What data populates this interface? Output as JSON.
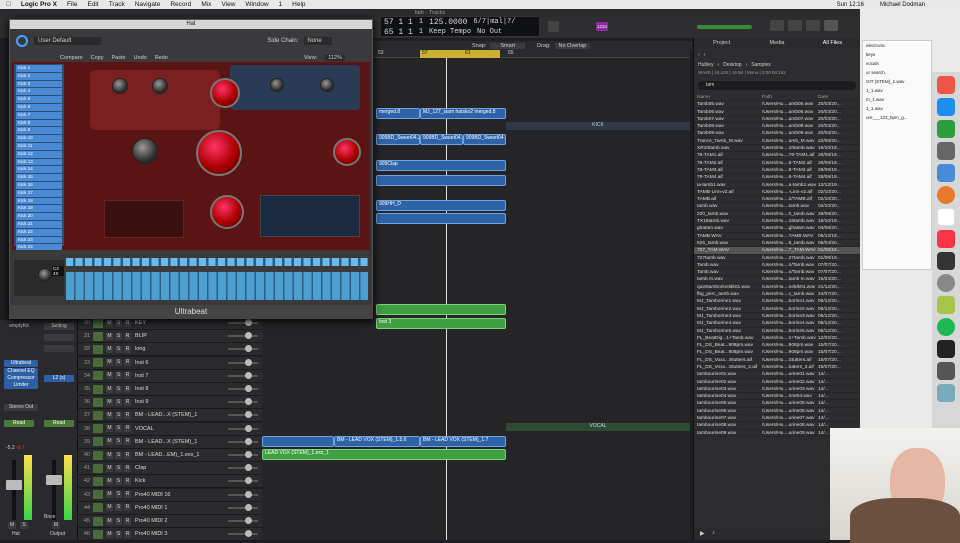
{
  "menubar": {
    "app": "Logic Pro X",
    "items": [
      "File",
      "Edit",
      "Track",
      "Navigate",
      "Record",
      "Mix",
      "View",
      "Window",
      "1",
      "Help"
    ],
    "clock": "Sun 12:16",
    "user": "Michael Dodman"
  },
  "window_title": "fadr - Tracks",
  "lcd": {
    "bar1": "57 1 1",
    "beat1": "1",
    "tempo": "125.0000",
    "sig": "6/7|mal|7/",
    "bar2": "65 1 1",
    "beat2": "1",
    "keep": "Keep Tempo",
    "no_out": "No Out"
  },
  "cpu_badge": "1234",
  "snap": {
    "label": "Snap:",
    "value": "Smart"
  },
  "drag": {
    "label": "Drag:",
    "value": "No Overlap"
  },
  "ruler_marks": [
    "53",
    "57",
    "61",
    "65"
  ],
  "ultrabeat": {
    "title": "Hat",
    "preset": "User Default",
    "sidechain_label": "Side Chain:",
    "sidechain_value": "None",
    "compare": "Compare",
    "copy": "Copy",
    "paste": "Paste",
    "undo": "Undo",
    "redo": "Redo",
    "view_label": "View:",
    "view_value": "112%",
    "footer": "Ultrabeat",
    "voice_value": "C3 4X",
    "drums": [
      "Kick 1",
      "Kick 2",
      "Kick 3",
      "Kick 4",
      "Kick 5",
      "Kick 6",
      "Kick 7",
      "Kick 8",
      "Kick 9",
      "Kick 10",
      "Kick 11",
      "Kick 12",
      "Kick 13",
      "Kick 14",
      "Kick 15",
      "Kick 16",
      "Kick 17",
      "Kick 18",
      "Kick 19",
      "Kick 20",
      "Kick 21",
      "Kick 22",
      "Kick 23",
      "Kick 24",
      "Kick 25"
    ]
  },
  "regions": [
    {
      "text": "merged.8",
      "color": "blue"
    },
    {
      "text": "MJ_127_siam hatsko2 merged.8",
      "color": "blue"
    },
    {
      "text": "909BD_Sweet04.21",
      "color": "blue"
    },
    {
      "text": "909BD_Sweet04.22",
      "color": "blue"
    },
    {
      "text": "909BD_Sweet04.23",
      "color": "blue"
    },
    {
      "text": "909Clap",
      "color": "blue"
    },
    {
      "text": "909HH_D",
      "color": "blue"
    },
    {
      "text": "Inst 3",
      "color": "green"
    },
    {
      "text": "BM - LEAD VOX (STEM)_1.5.6",
      "color": "blue"
    },
    {
      "text": "BM - LEAD VOX (STEM)_1.5.8",
      "color": "blue"
    },
    {
      "text": "BM - LEAD VOX (STEM)_1.7",
      "color": "blue"
    },
    {
      "text": "LEAD VOX (STEM)_1.exs_1",
      "color": "green"
    }
  ],
  "markers": {
    "kick": "KICK",
    "vocal": "VOCAL"
  },
  "tracks": [
    {
      "num": "30",
      "name": "KEY"
    },
    {
      "num": "31",
      "name": "BLIP"
    },
    {
      "num": "32",
      "name": "long"
    },
    {
      "num": "33",
      "name": "Inst 6"
    },
    {
      "num": "34",
      "name": "Inst 7"
    },
    {
      "num": "35",
      "name": "Inst 8"
    },
    {
      "num": "36",
      "name": "Inst 9"
    },
    {
      "num": "37",
      "name": "BM - LEAD...X (STEM)_1"
    },
    {
      "num": "38",
      "name": "VOCAL"
    },
    {
      "num": "39",
      "name": "BM - LEAD...X (STEM)_1"
    },
    {
      "num": "40",
      "name": "BM - LEAD...EM)_1.exs_1"
    },
    {
      "num": "41",
      "name": "Clap"
    },
    {
      "num": "42",
      "name": "Kick"
    },
    {
      "num": "43",
      "name": "Pro40 MIDI 16"
    },
    {
      "num": "44",
      "name": "Pro40 MIDI 1"
    },
    {
      "num": "45",
      "name": "Pro40 MIDI 2"
    },
    {
      "num": "46",
      "name": "Pro40 MIDI 3"
    }
  ],
  "mixer": {
    "plugin": "emptyKit",
    "setting": "Setting",
    "ultrabeat": "Ultrabeat",
    "channel_eq": "Channel EQ",
    "compressor": "Compressor",
    "limiter": "Limiter",
    "l2": "L2 (s)",
    "stereo_out": "Stereo Out",
    "read": "Read",
    "vol1": "-5.2",
    "vol2": "-9.7",
    "bnce": "Bnce",
    "hat": "Hat",
    "output": "Output",
    "m": "M",
    "s": "S"
  },
  "browser": {
    "tabs": [
      "Project",
      "Media",
      "All Files"
    ],
    "path": [
      "Hubley",
      "Desktop",
      "Samples"
    ],
    "info": "WAVE | 44,100 | 16 Bit | Mono | 0:00:00:162",
    "search": "tam",
    "cols": [
      "Name",
      "Path",
      "Date"
    ],
    "files": [
      [
        "Tamb05.wav",
        "/Users/Hu....amb05.wav",
        "20/03/20..."
      ],
      [
        "Tamb06.wav",
        "/Users/Hu....amb06.wav",
        "20/03/20..."
      ],
      [
        "Tamb07.wav",
        "/Users/Hu....amb07.wav",
        "20/03/20..."
      ],
      [
        "Tamb08.wav",
        "/Users/Hu....amb08.wav",
        "20/03/20..."
      ],
      [
        "Tamb09.wav",
        "/Users/Hu....amb09.wav",
        "20/03/20..."
      ],
      [
        "Trance_Tamb_M.wav",
        "/Users/Hu....amb_M.wav",
        "22/08/20..."
      ],
      [
        "XR10tamb.wav",
        "/Users/Hu....10tamb.wav",
        "19/10/19..."
      ],
      [
        "78-TAM1.aif",
        "/Users/Hu....78-TAM1.aif",
        "28/09/19..."
      ],
      [
        "78-TAM2.aif",
        "/Users/Hu....8-TAM2.aif",
        "28/09/19..."
      ],
      [
        "78-TAM3.aif",
        "/Users/Hu....8-TAM3.aif",
        "28/09/19..."
      ],
      [
        "78-TAM4.aif",
        "/Users/Hu....8-TAM4.aif",
        "28/09/19..."
      ],
      [
        "ia-tamb1.wav",
        "/Users/Hu....a-tamb1.wav",
        "13/12/19..."
      ],
      [
        "TAMB-Linn-v2.aif",
        "/Users/Hu....-Linn-v2.aif",
        "02/10/20..."
      ],
      [
        "TAMB.aif",
        "/Users/Hu....2/TAMB.aif",
        "02/10/20..."
      ],
      [
        "tamb.wav",
        "/Users/Hu....tamb.wav",
        "02/10/20..."
      ],
      [
        "220_tamb.wav",
        "/Users/Hu....0_tamb.wav",
        "28/09/20..."
      ],
      [
        "TX16tamb.wav",
        "/Users/Hu....16tamb.wav",
        "19/10/19..."
      ],
      [
        "ghatam.wav",
        "/Users/Hu....ghatam.wav",
        "04/08/20..."
      ],
      [
        "TAMB.WAV",
        "/Users/Hu....TAMB.WAV",
        "06/12/19..."
      ],
      [
        "626_tamb.wav",
        "/Users/Hu....6_tamb.wav",
        "06/04/20..."
      ],
      [
        "707_TAM.WAV",
        "/Users/Hu....7_TAM.WAV",
        "01/08/19..."
      ],
      [
        "727tamb.wav",
        "/Users/Hu....27tamb.wav",
        "01/08/19..."
      ],
      [
        "Tamb.wav",
        "/Users/Hu....n/Tamb.wav",
        "07/07/20..."
      ],
      [
        "Tamb.wav",
        "/Users/Hu....n/Tamb.wav",
        "07/07/20..."
      ],
      [
        "tamb m.wav",
        "/Users/Hu....tamb m.wav",
        "15/04/20..."
      ],
      [
        "quiettamborineldk01.wav",
        "/Users/Hu....neldk01.wav",
        "21/12/20..."
      ],
      [
        "fbg_perc_tamb.wav",
        "/Users/Hu....c_tamb.wav",
        "24/07/20..."
      ],
      [
        "MJ_Tamborine1.wav",
        "/Users/Hu....borine1.wav",
        "06/12/20..."
      ],
      [
        "MJ_Tamborine2.wav",
        "/Users/Hu....borine2.wav",
        "06/12/20..."
      ],
      [
        "MJ_Tamborine3.wav",
        "/Users/Hu....borine3.wav",
        "06/12/20..."
      ],
      [
        "MJ_Tamborine4.wav",
        "/Users/Hu....borine4.wav",
        "06/12/20..."
      ],
      [
        "MJ_Tamborine5.wav",
        "/Users/Hu....borine5.wav",
        "06/12/20..."
      ],
      [
        "FL_BeatDig...1+Tamb.wav",
        "/Users/Hu....1+Tamb.wav",
        "12/02/20..."
      ],
      [
        "FL_DS_Beat...908pm.wav",
        "/Users/Hu....908pm.wav",
        "15/07/20..."
      ],
      [
        "FL_DS_Beat...908pm.wav",
        "/Users/Hu....908pm.wav",
        "15/07/20..."
      ],
      [
        "FL_DS_Voxx...Stutters.aif",
        "/Users/Hu....Stutters.aif",
        "15/07/20..."
      ],
      [
        "FL_DS_Voxx...Stutters_2.aif",
        "/Users/Hu....tutters_2.aif",
        "15/07/20..."
      ],
      [
        "tambourine01.wav",
        "/Users/Hu....urine01.wav",
        "14/..."
      ],
      [
        "tambourine02.wav",
        "/Users/Hu....urine02.wav",
        "14/..."
      ],
      [
        "tambourine03.wav",
        "/Users/Hu....urine03.wav",
        "14/..."
      ],
      [
        "tambourine04.wav",
        "/Users/Hu....rine04.wav",
        "14/..."
      ],
      [
        "tambourine05.wav",
        "/Users/Hu....urine05.wav",
        "14/..."
      ],
      [
        "tambourine06.wav",
        "/Users/Hu....urine06.wav",
        "14/..."
      ],
      [
        "tambourine07.wav",
        "/Users/Hu....urine07.wav",
        "14/..."
      ],
      [
        "tambourine08.wav",
        "/Users/Hu....urine08.wav",
        "14/..."
      ],
      [
        "tambourine09.wav",
        "/Users/Hu....urine09.wav",
        "14/..."
      ]
    ],
    "selected_index": 20
  },
  "desktop": {
    "finder_lines": [
      "electronic",
      "keys",
      "vocals",
      "ur search.",
      "GIT (STEM)_1.wav",
      "1_1.wav",
      "m_1.wav",
      "1_1.wav",
      "ure___123_bpm_g..."
    ]
  },
  "colors": {
    "region_blue": "#2f63a8",
    "region_green": "#3ea043",
    "ub_red": "#5a1414",
    "cycle": "#c9b033"
  }
}
